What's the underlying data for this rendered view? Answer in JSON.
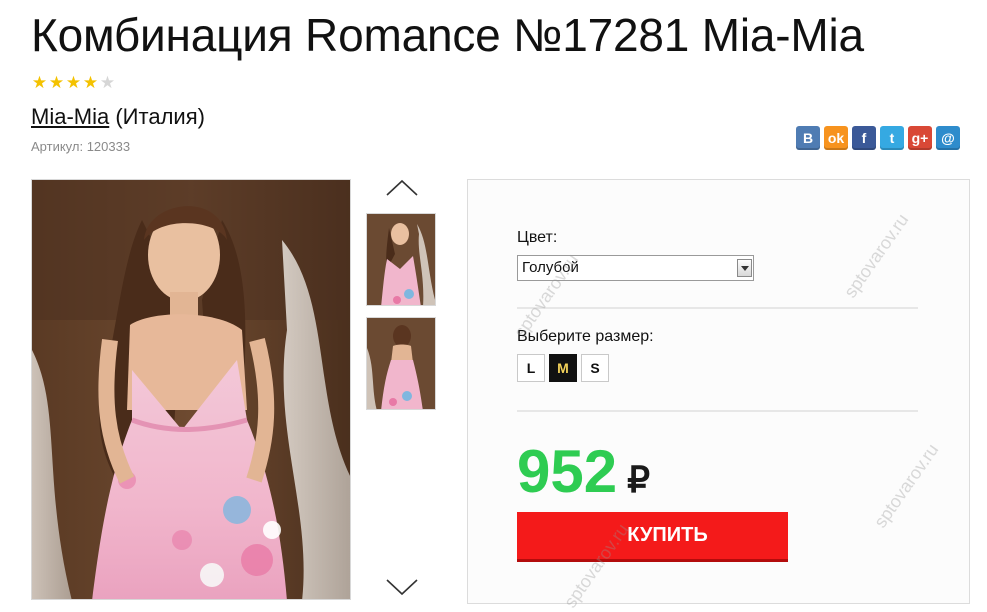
{
  "product": {
    "title": "Комбинация Romance №17281 Mia-Mia",
    "rating": 4,
    "rating_max": 5,
    "brand": "Mia-Mia",
    "country": "(Италия)",
    "sku": "Артикул: 120333"
  },
  "share": {
    "buttons": [
      {
        "name": "vk",
        "glyph": "B",
        "color": "#4f7cb3"
      },
      {
        "name": "odnoklassniki",
        "glyph": "ok",
        "color": "#f7931e"
      },
      {
        "name": "facebook",
        "glyph": "f",
        "color": "#3b5998"
      },
      {
        "name": "twitter",
        "glyph": "t",
        "color": "#35a9e2"
      },
      {
        "name": "google-plus",
        "glyph": "g+",
        "color": "#d94836"
      },
      {
        "name": "mail",
        "glyph": "@",
        "color": "#2e8ccc"
      }
    ]
  },
  "purchase": {
    "color_label": "Цвет:",
    "color_value": "Голубой",
    "size_label": "Выберите размер:",
    "sizes": [
      "L",
      "M",
      "S"
    ],
    "selected_size": "M",
    "price": "952",
    "currency": "₽",
    "buy_label": "КУПИТЬ"
  },
  "colors": {
    "price": "#2ecc52",
    "buy": "#f41a1a",
    "star": "#f4c200"
  },
  "watermark": "sptovarov.ru"
}
